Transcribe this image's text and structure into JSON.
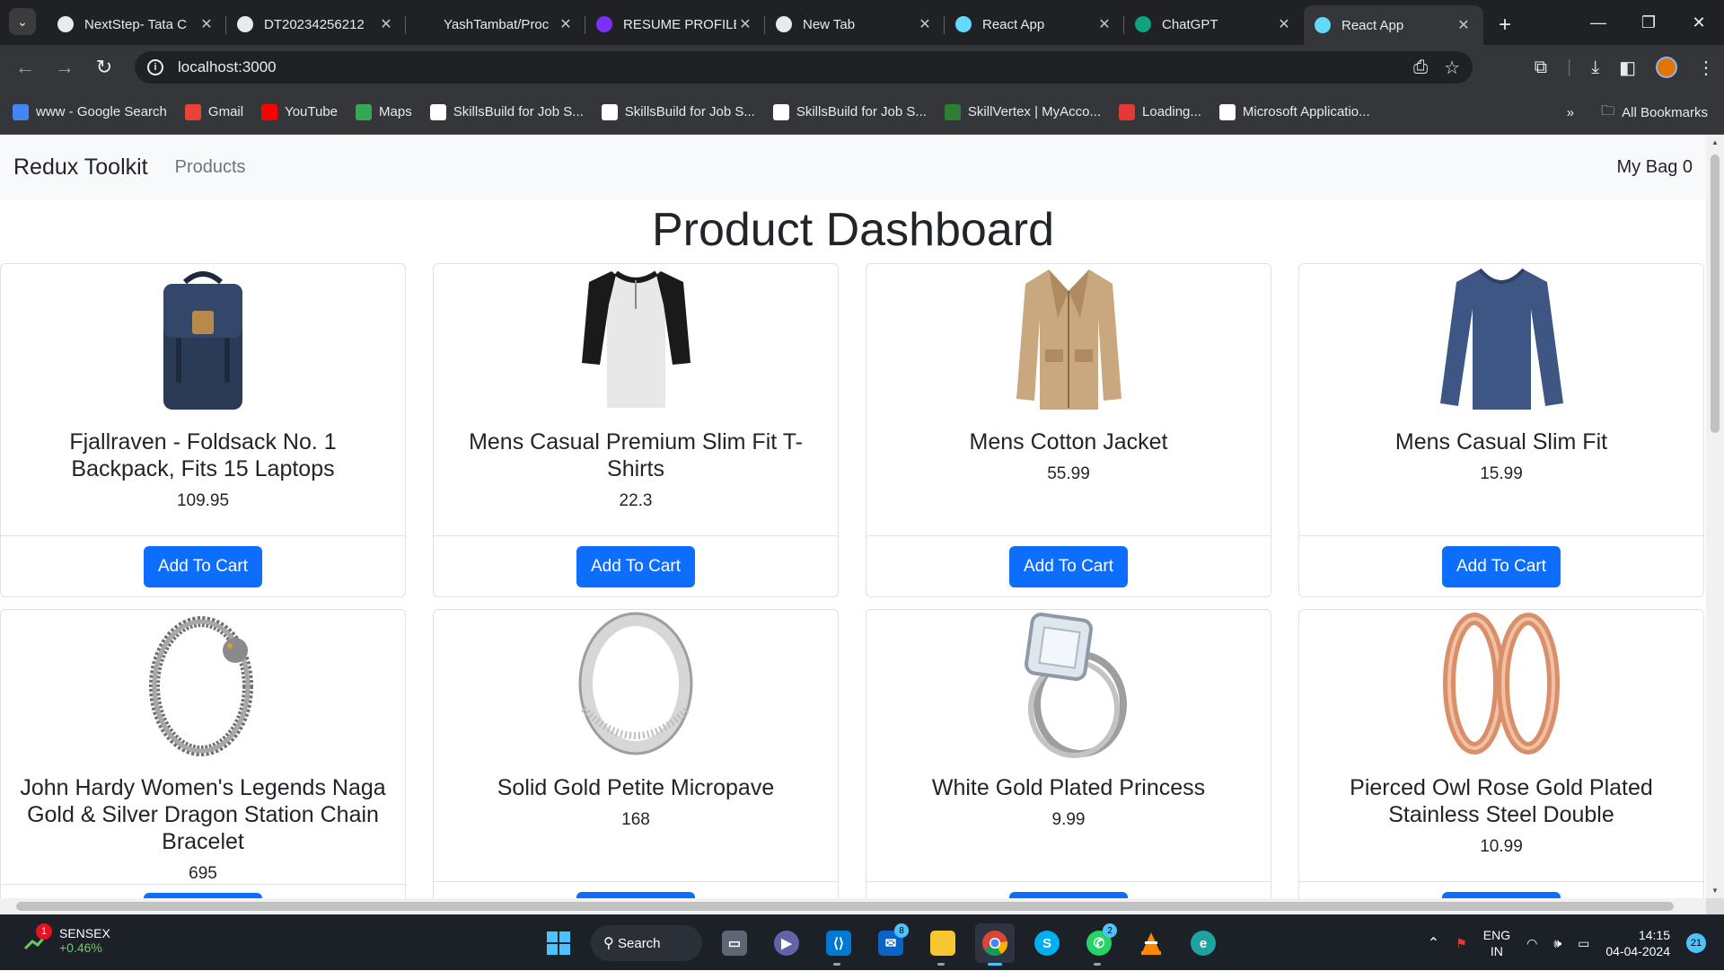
{
  "browser": {
    "tabs": [
      {
        "title": "NextStep- Tata C",
        "icon": "tcs-icon",
        "color": "#e8eaed"
      },
      {
        "title": "DT20234256212",
        "icon": "globe-icon",
        "color": "#e8eaed"
      },
      {
        "title": "YashTambat/Proc",
        "icon": "github-icon",
        "color": "#202124"
      },
      {
        "title": "RESUME PROFILE",
        "icon": "purple-logo-icon",
        "color": "#7b2ff7"
      },
      {
        "title": "New Tab",
        "icon": "chrome-icon",
        "color": "#e8eaed"
      },
      {
        "title": "React App",
        "icon": "react-icon",
        "color": "#61dafb"
      },
      {
        "title": "ChatGPT",
        "icon": "chatgpt-icon",
        "color": "#10a37f"
      },
      {
        "title": "React App",
        "icon": "react-icon",
        "color": "#61dafb"
      }
    ],
    "active_tab": 7,
    "url": "localhost:3000",
    "bookmarks": [
      {
        "label": "www - Google Search",
        "icon": "google-icon",
        "color": "#4285f4"
      },
      {
        "label": "Gmail",
        "icon": "gmail-icon",
        "color": "#ea4335"
      },
      {
        "label": "YouTube",
        "icon": "youtube-icon",
        "color": "#ff0000"
      },
      {
        "label": "Maps",
        "icon": "maps-icon",
        "color": "#34a853"
      },
      {
        "label": "SkillsBuild for Job S...",
        "icon": "skillsbuild-icon",
        "color": "#ffffff"
      },
      {
        "label": "SkillsBuild for Job S...",
        "icon": "skillsbuild-icon",
        "color": "#ffffff"
      },
      {
        "label": "SkillsBuild for Job S...",
        "icon": "skillsbuild-icon",
        "color": "#ffffff"
      },
      {
        "label": "SkillVertex | MyAcco...",
        "icon": "skillvertex-icon",
        "color": "#2e7d32"
      },
      {
        "label": "Loading...",
        "icon": "loading-icon",
        "color": "#e53935"
      },
      {
        "label": "Microsoft Applicatio...",
        "icon": "microsoft-icon",
        "color": "#ffffff"
      }
    ],
    "all_bookmarks": "All Bookmarks"
  },
  "app": {
    "brand": "Redux Toolkit",
    "nav_products": "Products",
    "bag": "My Bag 0",
    "heading": "Product Dashboard",
    "add_label": "Add To Cart",
    "products": [
      {
        "title": "Fjallraven - Foldsack No. 1 Backpack, Fits 15 Laptops",
        "price": "109.95",
        "image": "backpack"
      },
      {
        "title": "Mens Casual Premium Slim Fit T-Shirts",
        "price": "22.3",
        "image": "raglan-tshirt"
      },
      {
        "title": "Mens Cotton Jacket",
        "price": "55.99",
        "image": "jacket"
      },
      {
        "title": "Mens Casual Slim Fit",
        "price": "15.99",
        "image": "longsleeve"
      },
      {
        "title": "John Hardy Women's Legends Naga Gold & Silver Dragon Station Chain Bracelet",
        "price": "695",
        "image": "bracelet"
      },
      {
        "title": "Solid Gold Petite Micropave",
        "price": "168",
        "image": "silver-ring"
      },
      {
        "title": "White Gold Plated Princess",
        "price": "9.99",
        "image": "diamond-ring"
      },
      {
        "title": "Pierced Owl Rose Gold Plated Stainless Steel Double",
        "price": "10.99",
        "image": "rose-gold-earrings"
      }
    ]
  },
  "taskbar": {
    "sensex_label": "SENSEX",
    "sensex_change": "+0.46%",
    "sensex_badge": "1",
    "search": "Search",
    "mail_badge": "8",
    "whatsapp_badge": "2",
    "lang1": "ENG",
    "lang2": "IN",
    "time": "14:15",
    "date": "04-04-2024",
    "notifications": "21"
  }
}
